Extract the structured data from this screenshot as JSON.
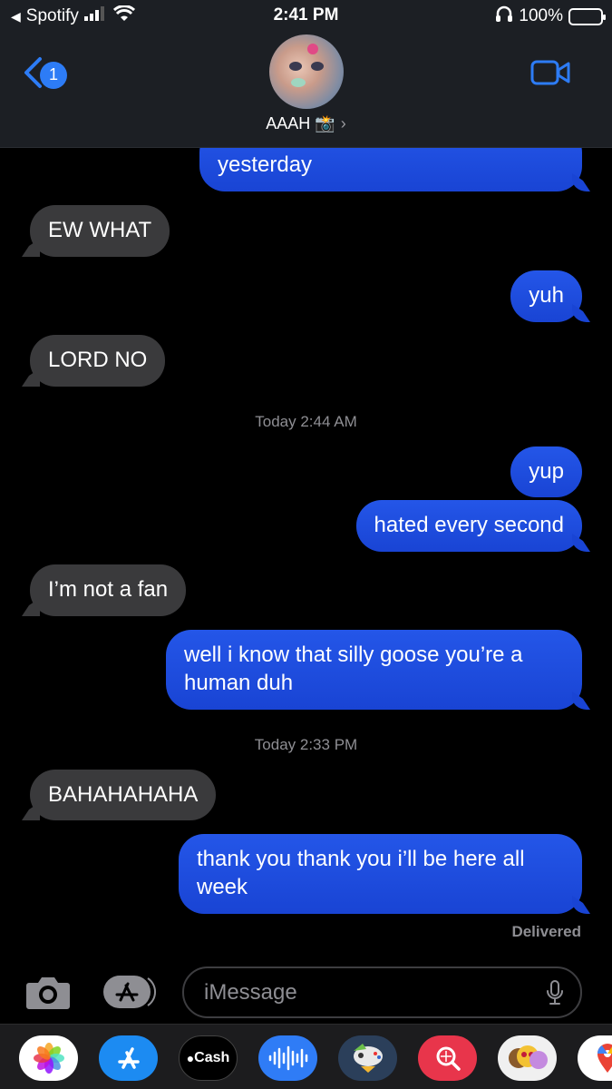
{
  "status_bar": {
    "back_app": "Spotify",
    "time": "2:41 PM",
    "battery": "100%"
  },
  "header": {
    "back_badge": "1",
    "contact_name": "AAAH 📸",
    "chevron": "›"
  },
  "messages": [
    {
      "from": "me",
      "text": "yesterday"
    },
    {
      "from": "them",
      "text": "EW WHAT"
    },
    {
      "from": "me",
      "text": "yuh"
    },
    {
      "from": "them",
      "text": "LORD NO"
    },
    {
      "from": "timestamp",
      "text": "Today 2:44 AM"
    },
    {
      "from": "me",
      "text": "yup"
    },
    {
      "from": "me",
      "text": "hated every second"
    },
    {
      "from": "them",
      "text": "I’m not a fan"
    },
    {
      "from": "me",
      "text": "well i know that silly goose you’re a human duh"
    },
    {
      "from": "timestamp",
      "text": "Today 2:33 PM"
    },
    {
      "from": "them",
      "text": "BAHAHAHAHA"
    },
    {
      "from": "me",
      "text": "thank you thank you i’ll be here all week"
    }
  ],
  "delivered_label": "Delivered",
  "input": {
    "placeholder": "iMessage"
  },
  "app_drawer": [
    {
      "icon": "photos-icon",
      "label": ""
    },
    {
      "icon": "app-store-icon",
      "label": ""
    },
    {
      "icon": "apple-cash-icon",
      "label": "Cash"
    },
    {
      "icon": "audio-message-icon",
      "label": ""
    },
    {
      "icon": "game-pigeon-icon",
      "label": ""
    },
    {
      "icon": "search-images-icon",
      "label": ""
    },
    {
      "icon": "memoji-icon",
      "label": ""
    },
    {
      "icon": "google-maps-icon",
      "label": ""
    }
  ],
  "colors": {
    "outgoing_bubble": "#1d50e0",
    "incoming_bubble": "#3a3a3c",
    "accent": "#2d7cf6"
  }
}
